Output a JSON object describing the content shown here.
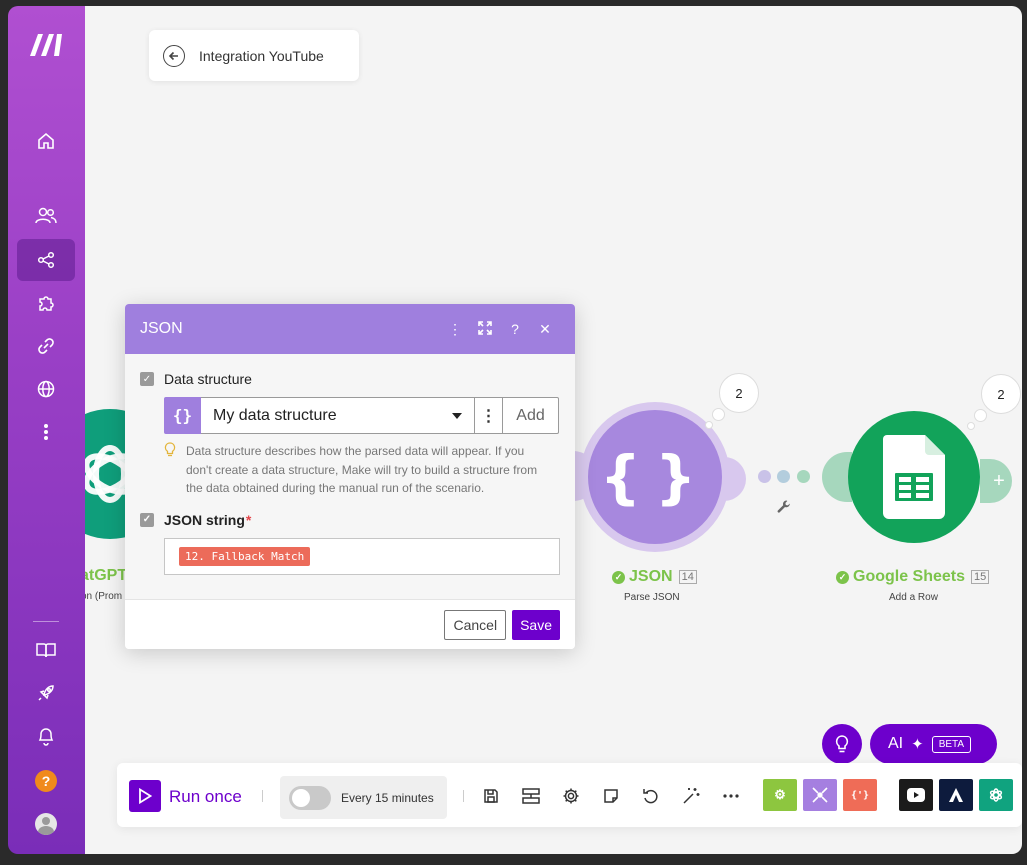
{
  "header": {
    "back_title": "Integration YouTube"
  },
  "modules": {
    "chatgpt": {
      "label": "atGPT",
      "sub": "on (Prom"
    },
    "json": {
      "label": "JSON",
      "num": "14",
      "sub": "Parse JSON",
      "bubble": "2"
    },
    "sheets": {
      "label": "Google Sheets",
      "num": "15",
      "sub": "Add a Row",
      "bubble": "2"
    }
  },
  "dialog": {
    "title": "JSON",
    "data_structure_label": "Data structure",
    "select_icon": "{}",
    "selected_structure": "My data structure",
    "add_label": "Add",
    "hint": "Data structure describes how the parsed data will appear. If you don't create a data structure, Make will try to build a structure from the data obtained during the manual run of the scenario.",
    "json_string_label": "JSON string",
    "required_mark": "*",
    "json_string_pill": "12. Fallback Match",
    "cancel_label": "Cancel",
    "save_label": "Save"
  },
  "ai": {
    "label": "AI",
    "badge": "BETA"
  },
  "toolbar": {
    "run_label": "Run once",
    "schedule_text": "Every 15 minutes"
  },
  "colors": {
    "accent": "#6d00cc",
    "sidebar": "#9a40c6",
    "json_module": "#a788de",
    "sheets_module": "#12a35a",
    "chatgpt_module": "#0f9e7b",
    "success": "#7cc34a"
  }
}
